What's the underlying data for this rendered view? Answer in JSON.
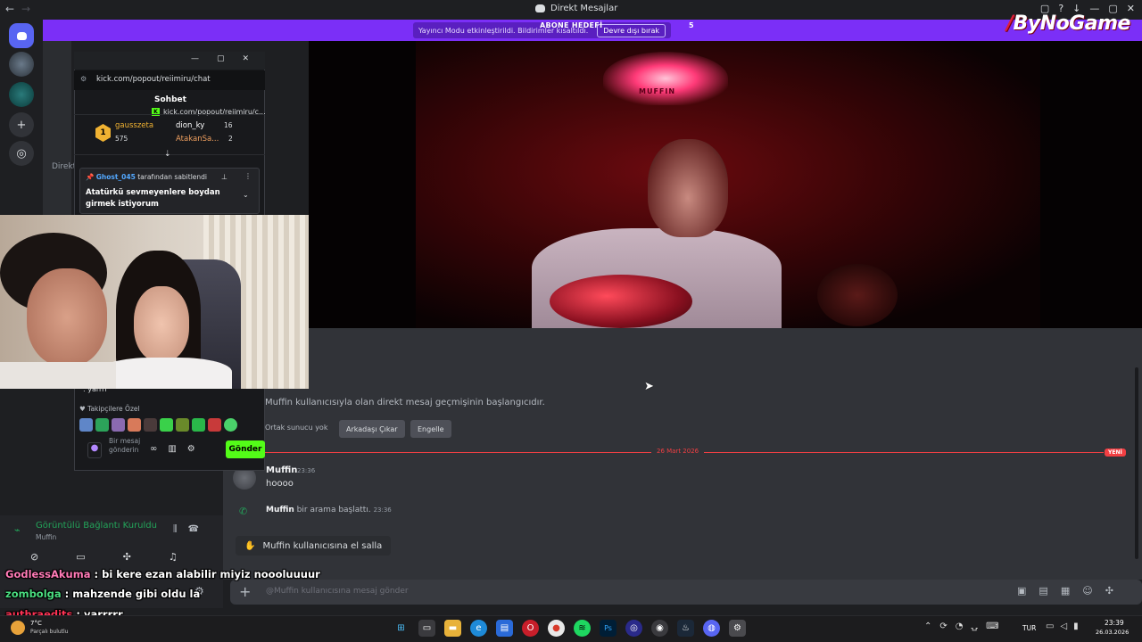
{
  "window": {
    "title": "Direkt Mesajlar",
    "back_glyph": "←",
    "fwd_glyph": "→",
    "controls": [
      "▢",
      "?",
      "↓",
      "—",
      "▢",
      "✕"
    ]
  },
  "banner": {
    "notice": "Yayıncı Modu etkinleştirildi. Bildirimler kısaltıldı.",
    "disable_label": "Devre dışı bırak",
    "sub_goal": "ABONE HEDEFİ",
    "sub_goal_count": "5"
  },
  "brand_logo": {
    "part1": "/",
    "part2": "ByNoGame"
  },
  "rail": {
    "plus": "+",
    "compass": "◎"
  },
  "direkt_label": "Direkt",
  "neon_text": "MUFFIN",
  "kick": {
    "tab_title": "kick.com/popout/reiimiru/c...",
    "url": "kick.com/popout/reiimiru/chat",
    "logo": "K",
    "chat_title": "Sohbet",
    "leaderboard": {
      "rank": "1",
      "u1": {
        "name": "gausszeta",
        "count": "575"
      },
      "u2": {
        "name": "dion_ky",
        "count": "16"
      },
      "u3": {
        "name": "AtakanSa...",
        "count": "2"
      }
    },
    "pinned": {
      "by_user": "Ghost_045",
      "by_suffix": " tarafından sabitlendi",
      "text": "Atatürkü sevmeyenlere boydan girmek istiyorum"
    },
    "last_line": ": yarrrr",
    "followers_label": "♥ Takipçilere Özel",
    "input_placeholder": "Bir mesaj gönderin",
    "send_label": "Gönder"
  },
  "chat": {
    "start_text": "Muffin kullanıcısıyla olan direkt mesaj geçmişinin başlangıcıdır.",
    "mutual_text": "Ortak sunucu yok",
    "remove_friend": "Arkadaşı Çıkar",
    "block": "Engelle",
    "date": "26 Mart 2026",
    "new_badge": "YENİ",
    "message": {
      "author": "Muffin",
      "time": "23:36",
      "text": "hoooo"
    },
    "call": {
      "author": "Muffin",
      "text": " bir arama başlattı.",
      "time": "23:36"
    },
    "wave_label": "Muffin kullanıcısına el salla",
    "composer_placeholder": "@Muffin kullanıcısına mesaj gönder"
  },
  "voice": {
    "status": "Görüntülü Bağlantı Kuruldu",
    "channel": "Muffin"
  },
  "overlay_chat": [
    {
      "user": "GodlessAkuma",
      "msg": " : bi kere ezan alabilir miyiz noooluuuur"
    },
    {
      "user": "zombolga",
      "msg": " : mahzende gibi oldu la"
    },
    {
      "user": "authraedits",
      "msg": " : yarrrrr"
    }
  ],
  "taskbar": {
    "temp": "7°C",
    "weather": "Parçalı bulutlu",
    "lang": "TUR",
    "time": "23:39",
    "date": "26.03.2026"
  },
  "colors": {
    "accent": "#5865f2",
    "kick_green": "#53fc18",
    "banner": "#7b2ff7",
    "danger": "#f23f43"
  }
}
